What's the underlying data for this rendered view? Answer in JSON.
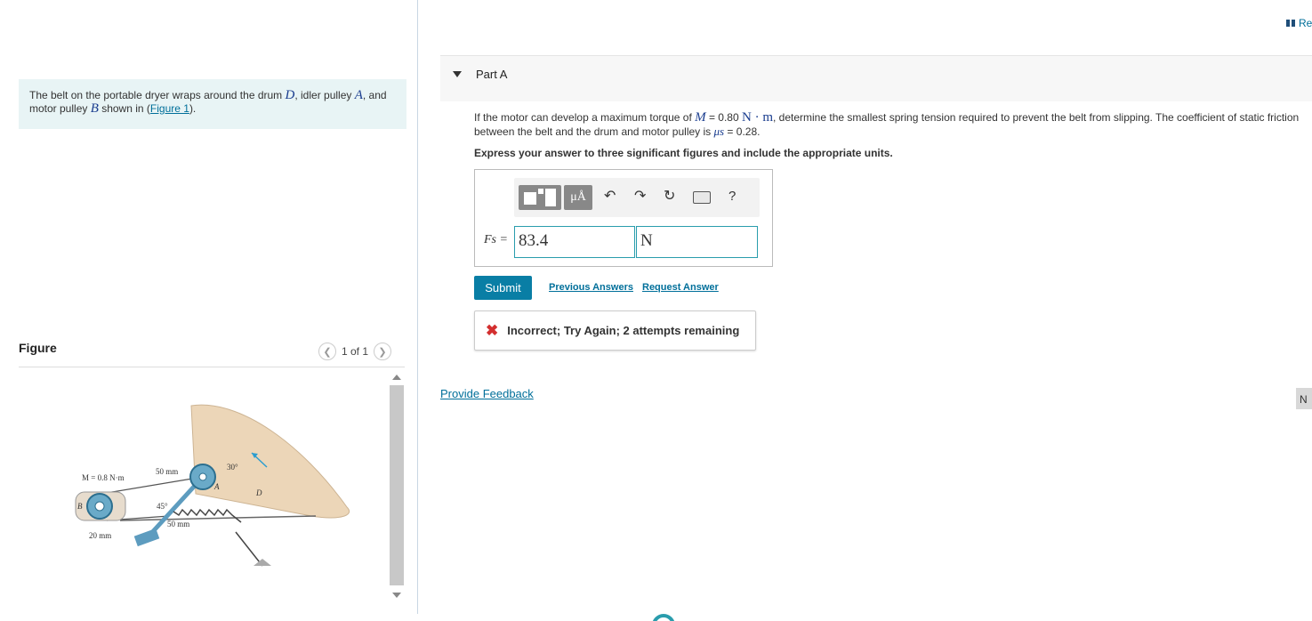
{
  "problem": {
    "text_1": "The belt on the portable dryer wraps around the drum ",
    "sym_D": "D",
    "text_2": ", idler pulley ",
    "sym_A": "A",
    "text_3": ", and motor pulley ",
    "sym_B": "B",
    "text_4": " shown in (",
    "figure_link": "Figure 1",
    "text_5": ")."
  },
  "figure": {
    "title": "Figure",
    "pager": "1 of 1",
    "prev_icon": "chevron-left-icon",
    "next_icon": "chevron-right-icon",
    "labels": {
      "moment": "M = 0.8 N·m",
      "dist_top": "50 mm",
      "dist_bottom": "50 mm",
      "radius": "20 mm",
      "angle_45": "45°",
      "angle_30": "30°",
      "pt_A": "A",
      "pt_B": "B",
      "pt_D": "D"
    }
  },
  "header": {
    "review_label": "Re"
  },
  "part": {
    "title": "Part A",
    "question_1": "If the motor can develop a maximum torque of ",
    "sym_M": "M",
    "question_2": " = 0.80 ",
    "unit_Nm": "N · m",
    "question_3": ", determine the smallest spring tension required to prevent the belt from slipping. The coefficient of static friction",
    "question_4": "between the belt and the drum and motor pulley is ",
    "sym_mu": "μs",
    "question_5": " = 0.28.",
    "instruction": "Express your answer to three significant figures and include the appropriate units."
  },
  "toolbar": {
    "template_icon": "templates-icon",
    "units_label": "μÅ",
    "undo_icon": "undo-icon",
    "redo_icon": "redo-icon",
    "reset_icon": "reset-icon",
    "keyboard_icon": "keyboard-icon",
    "help_label": "?"
  },
  "answer": {
    "label": "Fs =",
    "value": "83.4",
    "unit": "N"
  },
  "actions": {
    "submit": "Submit",
    "previous_answers": "Previous Answers",
    "request_answer": "Request Answer"
  },
  "feedback": {
    "icon": "x-icon",
    "text": "Incorrect; Try Again; 2 attempts remaining"
  },
  "footer": {
    "provide_feedback": "Provide Feedback",
    "next_label": "N"
  },
  "colors": {
    "accent": "#097ea5",
    "link": "#006f9a",
    "error": "#d32f2f",
    "problem_bg": "#e8f4f5",
    "input_border": "#2a9dad"
  }
}
